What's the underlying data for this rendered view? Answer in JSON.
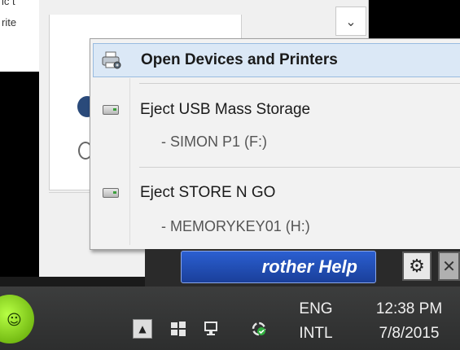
{
  "background": {
    "left_fragment_lines": [
      "ic t",
      "rite"
    ]
  },
  "context_menu": {
    "items": [
      {
        "label": "Open Devices and Printers",
        "icon": "printer-icon"
      },
      {
        "label": "Eject USB Mass Storage",
        "icon": "usb-drive-icon",
        "sub": "- SIMON P1 (F:)"
      },
      {
        "label": "Eject STORE N GO",
        "icon": "usb-drive-icon",
        "sub": "- MEMORYKEY01 (H:)"
      }
    ]
  },
  "help_bar": {
    "label": "rother Help",
    "gear_icon": "gear-icon",
    "close_icon": "close-icon"
  },
  "taskbar": {
    "language": {
      "line1": "ENG",
      "line2": "INTL"
    },
    "clock": {
      "time": "12:38 PM",
      "date": "7/8/2015"
    },
    "tray_icons": [
      "show-hidden-icons-chevron",
      "windows-flag-icon",
      "network-icon",
      "sync-status-icon"
    ]
  },
  "colors": {
    "menu_highlight": "#dbe8f6",
    "help_button": "#2b5fd1",
    "taskbar": "#333434"
  }
}
